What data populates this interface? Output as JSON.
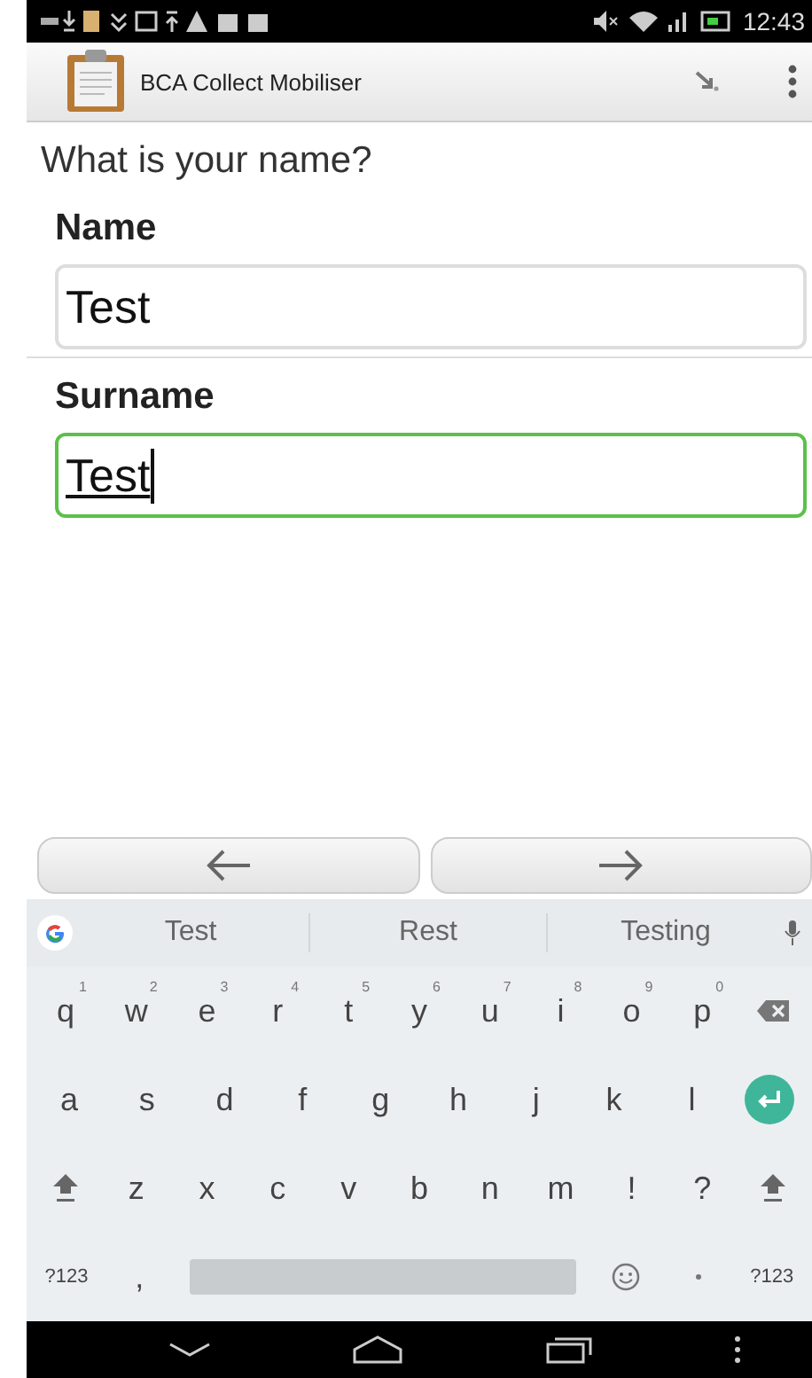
{
  "status_bar": {
    "time": "12:43"
  },
  "app_bar": {
    "title": "BCA Collect Mobiliser"
  },
  "question": "What is your name?",
  "fields": [
    {
      "label": "Name",
      "value": "Test",
      "focused": false
    },
    {
      "label": "Surname",
      "value": "Test",
      "focused": true
    }
  ],
  "suggestions": [
    "Test",
    "Rest",
    "Testing"
  ],
  "keyboard": {
    "rows": [
      [
        {
          "kind": "char",
          "label": "q",
          "hint": "1"
        },
        {
          "kind": "char",
          "label": "w",
          "hint": "2"
        },
        {
          "kind": "char",
          "label": "e",
          "hint": "3"
        },
        {
          "kind": "char",
          "label": "r",
          "hint": "4"
        },
        {
          "kind": "char",
          "label": "t",
          "hint": "5"
        },
        {
          "kind": "char",
          "label": "y",
          "hint": "6"
        },
        {
          "kind": "char",
          "label": "u",
          "hint": "7"
        },
        {
          "kind": "char",
          "label": "i",
          "hint": "8"
        },
        {
          "kind": "char",
          "label": "o",
          "hint": "9"
        },
        {
          "kind": "char",
          "label": "p",
          "hint": "0"
        },
        {
          "kind": "backspace"
        }
      ],
      [
        {
          "kind": "char",
          "label": "a"
        },
        {
          "kind": "char",
          "label": "s"
        },
        {
          "kind": "char",
          "label": "d"
        },
        {
          "kind": "char",
          "label": "f"
        },
        {
          "kind": "char",
          "label": "g"
        },
        {
          "kind": "char",
          "label": "h"
        },
        {
          "kind": "char",
          "label": "j"
        },
        {
          "kind": "char",
          "label": "k"
        },
        {
          "kind": "char",
          "label": "l"
        },
        {
          "kind": "enter"
        }
      ],
      [
        {
          "kind": "shift"
        },
        {
          "kind": "char",
          "label": "z"
        },
        {
          "kind": "char",
          "label": "x"
        },
        {
          "kind": "char",
          "label": "c"
        },
        {
          "kind": "char",
          "label": "v"
        },
        {
          "kind": "char",
          "label": "b"
        },
        {
          "kind": "char",
          "label": "n"
        },
        {
          "kind": "char",
          "label": "m"
        },
        {
          "kind": "char",
          "label": "!"
        },
        {
          "kind": "char",
          "label": "?"
        },
        {
          "kind": "shift"
        }
      ],
      [
        {
          "kind": "small",
          "label": "?123"
        },
        {
          "kind": "char",
          "label": ","
        },
        {
          "kind": "space"
        },
        {
          "kind": "emoji"
        },
        {
          "kind": "period"
        },
        {
          "kind": "small",
          "label": "?123"
        }
      ]
    ]
  }
}
